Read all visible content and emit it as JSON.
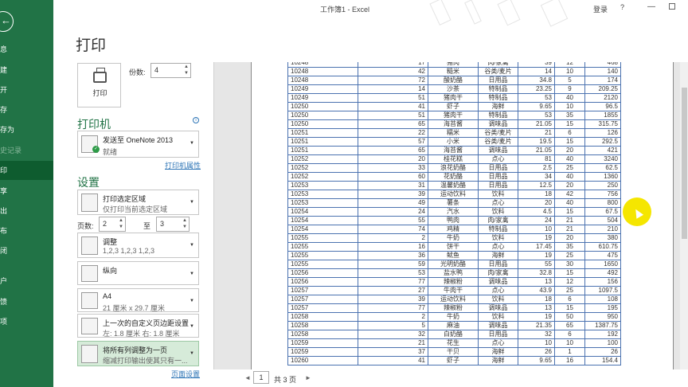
{
  "titlebar": {
    "title": "工作簿1 - Excel",
    "login": "登录",
    "help": "?",
    "minimize": "—"
  },
  "nav": {
    "back_icon": "←",
    "items": [
      {
        "label": "信息",
        "state": "normal"
      },
      {
        "label": "新建",
        "state": "normal"
      },
      {
        "label": "打开",
        "state": "normal"
      },
      {
        "label": "保存",
        "state": "normal"
      },
      {
        "label": "另存为",
        "state": "normal"
      },
      {
        "label": "历史记录",
        "state": "disabled"
      },
      {
        "label": "打印",
        "state": "active"
      },
      {
        "label": "共享",
        "state": "normal"
      },
      {
        "label": "导出",
        "state": "normal"
      },
      {
        "label": "发布",
        "state": "normal"
      },
      {
        "label": "关闭",
        "state": "normal"
      },
      {
        "label": "账户",
        "state": "normal"
      },
      {
        "label": "反馈",
        "state": "normal"
      },
      {
        "label": "选项",
        "state": "normal"
      }
    ]
  },
  "print": {
    "title": "打印",
    "button_label": "打印",
    "copies_label": "份数:",
    "copies_value": "4",
    "printer_section": "打印机",
    "printer_name": "发送至 OneNote 2013",
    "printer_status": "就绪",
    "printer_props_link": "打印机属性",
    "settings_section": "设置",
    "settings": [
      {
        "icon": "print-area-icon",
        "line1": "打印选定区域",
        "line2": "仅打印当前选定区域"
      },
      {
        "icon": "collate-icon",
        "line1": "调整",
        "line2": "1,2,3    1,2,3    1,2,3"
      },
      {
        "icon": "portrait-icon",
        "line1": "纵向",
        "line2": ""
      },
      {
        "icon": "paper-size-icon",
        "line1": "A4",
        "line2": "21 厘米 x 29.7 厘米"
      },
      {
        "icon": "margins-icon",
        "line1": "上一次的自定义页边距设置",
        "line2": "左: 1.8 厘米    右: 1.8 厘米"
      },
      {
        "icon": "scaling-icon",
        "line1": "将所有列调整为一页",
        "line2": "缩减打印输出使其只有一..."
      }
    ],
    "pages_label": "页数:",
    "pages_from": "2",
    "pages_to_label": "至",
    "pages_to": "3",
    "page_setup_link": "页面设置"
  },
  "preview": {
    "rows": [
      [
        "10248",
        "17",
        "猪肉",
        "肉/家禽",
        "39",
        "12",
        "468"
      ],
      [
        "10248",
        "42",
        "糙米",
        "谷类/麦片",
        "14",
        "10",
        "140"
      ],
      [
        "10248",
        "72",
        "酸奶酪",
        "日用品",
        "34.8",
        "5",
        "174"
      ],
      [
        "10249",
        "14",
        "沙茶",
        "特制品",
        "23.25",
        "9",
        "209.25"
      ],
      [
        "10249",
        "51",
        "猪肉干",
        "特制品",
        "53",
        "40",
        "2120"
      ],
      [
        "10250",
        "41",
        "虾子",
        "海鲜",
        "9.65",
        "10",
        "96.5"
      ],
      [
        "10250",
        "51",
        "猪肉干",
        "特制品",
        "53",
        "35",
        "1855"
      ],
      [
        "10250",
        "65",
        "海苔酱",
        "调味品",
        "21.05",
        "15",
        "315.75"
      ],
      [
        "10251",
        "22",
        "糯米",
        "谷类/麦片",
        "21",
        "6",
        "126"
      ],
      [
        "10251",
        "57",
        "小米",
        "谷类/麦片",
        "19.5",
        "15",
        "292.5"
      ],
      [
        "10251",
        "65",
        "海苔酱",
        "调味品",
        "21.05",
        "20",
        "421"
      ],
      [
        "10252",
        "20",
        "桂花糕",
        "点心",
        "81",
        "40",
        "3240"
      ],
      [
        "10252",
        "33",
        "浪花奶酪",
        "日用品",
        "2.5",
        "25",
        "62.5"
      ],
      [
        "10252",
        "60",
        "花奶酪",
        "日用品",
        "34",
        "40",
        "1360"
      ],
      [
        "10253",
        "31",
        "温馨奶酪",
        "日用品",
        "12.5",
        "20",
        "250"
      ],
      [
        "10253",
        "39",
        "运动饮料",
        "饮料",
        "18",
        "42",
        "756"
      ],
      [
        "10253",
        "49",
        "薯条",
        "点心",
        "20",
        "40",
        "800"
      ],
      [
        "10254",
        "24",
        "汽水",
        "饮料",
        "4.5",
        "15",
        "67.5"
      ],
      [
        "10254",
        "55",
        "鸭肉",
        "肉/家禽",
        "24",
        "21",
        "504"
      ],
      [
        "10254",
        "74",
        "鸡精",
        "特制品",
        "10",
        "21",
        "210"
      ],
      [
        "10255",
        "2",
        "牛奶",
        "饮料",
        "19",
        "20",
        "380"
      ],
      [
        "10255",
        "16",
        "饼干",
        "点心",
        "17.45",
        "35",
        "610.75"
      ],
      [
        "10255",
        "36",
        "鱿鱼",
        "海鲜",
        "19",
        "25",
        "475"
      ],
      [
        "10255",
        "59",
        "光明奶酪",
        "日用品",
        "55",
        "30",
        "1650"
      ],
      [
        "10256",
        "53",
        "盐水鸭",
        "肉/家禽",
        "32.8",
        "15",
        "492"
      ],
      [
        "10256",
        "77",
        "辣椒粉",
        "调味品",
        "13",
        "12",
        "156"
      ],
      [
        "10257",
        "27",
        "牛肉干",
        "点心",
        "43.9",
        "25",
        "1097.5"
      ],
      [
        "10257",
        "39",
        "运动饮料",
        "饮料",
        "18",
        "6",
        "108"
      ],
      [
        "10257",
        "77",
        "辣椒粉",
        "调味品",
        "13",
        "15",
        "195"
      ],
      [
        "10258",
        "2",
        "牛奶",
        "饮料",
        "19",
        "50",
        "950"
      ],
      [
        "10258",
        "5",
        "麻油",
        "调味品",
        "21.35",
        "65",
        "1387.75"
      ],
      [
        "10258",
        "32",
        "白奶酪",
        "日用品",
        "32",
        "6",
        "192"
      ],
      [
        "10259",
        "21",
        "花生",
        "点心",
        "10",
        "10",
        "100"
      ],
      [
        "10259",
        "37",
        "干贝",
        "海鲜",
        "26",
        "1",
        "26"
      ],
      [
        "10260",
        "41",
        "虾子",
        "海鲜",
        "9.65",
        "16",
        "154.4"
      ]
    ],
    "page_nav": {
      "prev": "◄",
      "current": "1",
      "total": "共 3 页",
      "next": "►"
    }
  },
  "colors": {
    "nav_bg": "#217346",
    "accent": "#217346",
    "link": "#2e75b6",
    "table_border": "#4b72b0"
  }
}
